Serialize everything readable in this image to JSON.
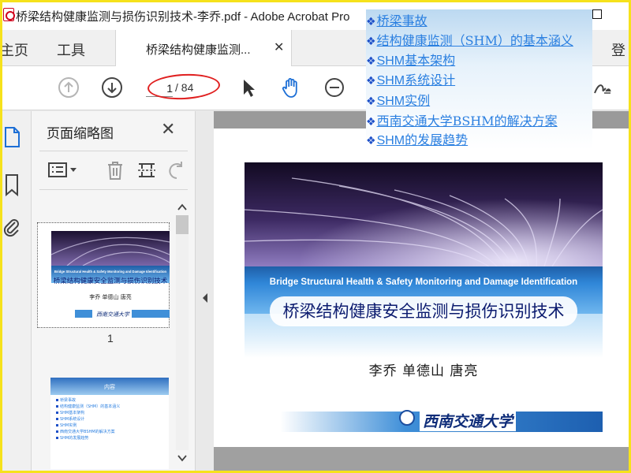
{
  "window": {
    "title": "桥梁结构健康监测与损伤识别技术-李乔.pdf - Adobe Acrobat Pro"
  },
  "tabs": {
    "home": "主页",
    "tools": "工具",
    "document": "桥梁结构健康监测...",
    "login": "登"
  },
  "toolbar": {
    "page_current": "1",
    "page_total": "/ 84"
  },
  "thumbnails_panel": {
    "title": "页面缩略图",
    "close_glyph": "✕",
    "page1_number": "1",
    "thumb1": {
      "en_subtitle": "Bridge Structural Health & Safety Monitoring and Damage Identification",
      "cn_title": "桥梁结构健康安全监测与损伤识别技术",
      "authors": "李乔 单德山 唐亮",
      "school": "西南交通大学"
    },
    "thumb2": {
      "heading": "内容",
      "items": [
        "桥梁事故",
        "结构健康监测（SHM）的基本涵义",
        "SHM基本架构",
        "SHM系统设计",
        "SHM实例",
        "西南交通大学BSHM的解决方案",
        "SHM的发展趋势"
      ]
    }
  },
  "slide": {
    "subtitle_en": "Bridge Structural Health & Safety Monitoring and Damage Identification",
    "title_cn": "桥梁结构健康安全监测与损伤识别技术",
    "authors": "李乔  单德山 唐亮",
    "school": "西南交通大学"
  },
  "toc_overlay": {
    "bullet": "❖",
    "items": [
      "桥梁事故",
      "结构健康监测（SHM）的基本涵义",
      "SHM基本架构",
      "SHM系统设计",
      "SHM实例",
      "西南交通大学BSHM的解决方案",
      "SHM的发展趋势"
    ]
  },
  "colors": {
    "frame": "#f6e21c",
    "annotation": "#e02020",
    "link": "#2a7fe0",
    "slide_title": "#0b1a6e"
  },
  "icons": [
    "pdf-icon",
    "maximize-icon",
    "close-icon",
    "arrow-up-circle-icon",
    "arrow-down-circle-icon",
    "pointer-icon",
    "hand-icon",
    "zoom-out-icon",
    "sign-icon",
    "page-icon",
    "bookmark-icon",
    "paperclip-icon",
    "options-icon",
    "trash-icon",
    "crop-icon",
    "undo-icon",
    "chevron-up-icon",
    "chevron-down-icon",
    "chevron-left-icon"
  ]
}
